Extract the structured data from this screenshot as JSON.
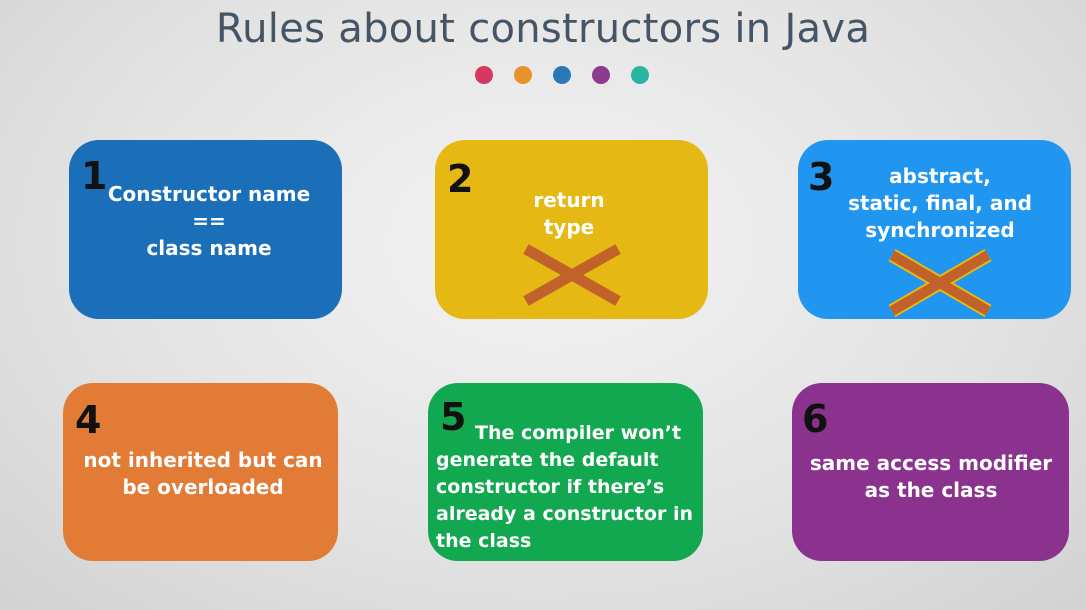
{
  "slide": {
    "title": "Rules about constructors in Java"
  },
  "dots": [
    "#d63864",
    "#e8922c",
    "#2a78b8",
    "#8e3a90",
    "#2bb5a0"
  ],
  "cards": [
    {
      "number": "1",
      "lines": [
        "Constructor name",
        "==",
        "class name"
      ],
      "color": "#1b6fb9"
    },
    {
      "number": "2",
      "lines": [
        "return",
        "type"
      ],
      "color": "#e6b813",
      "cross": "cross-icon"
    },
    {
      "number": "3",
      "lines": [
        "abstract,",
        "static, final, and",
        "synchronized"
      ],
      "color": "#2196f0",
      "cross": "cross-icon"
    },
    {
      "number": "4",
      "lines": [
        "not inherited but can",
        "be overloaded"
      ],
      "color": "#e17b35"
    },
    {
      "number": "5",
      "lines": [
        "The compiler won’t",
        "generate the default",
        "constructor if there’s",
        "already a constructor in",
        "the class"
      ],
      "color": "#12a84f"
    },
    {
      "number": "6",
      "lines": [
        "same access modifier",
        "as the class"
      ],
      "color": "#8b318e"
    }
  ],
  "cross_color": "#c0622a"
}
